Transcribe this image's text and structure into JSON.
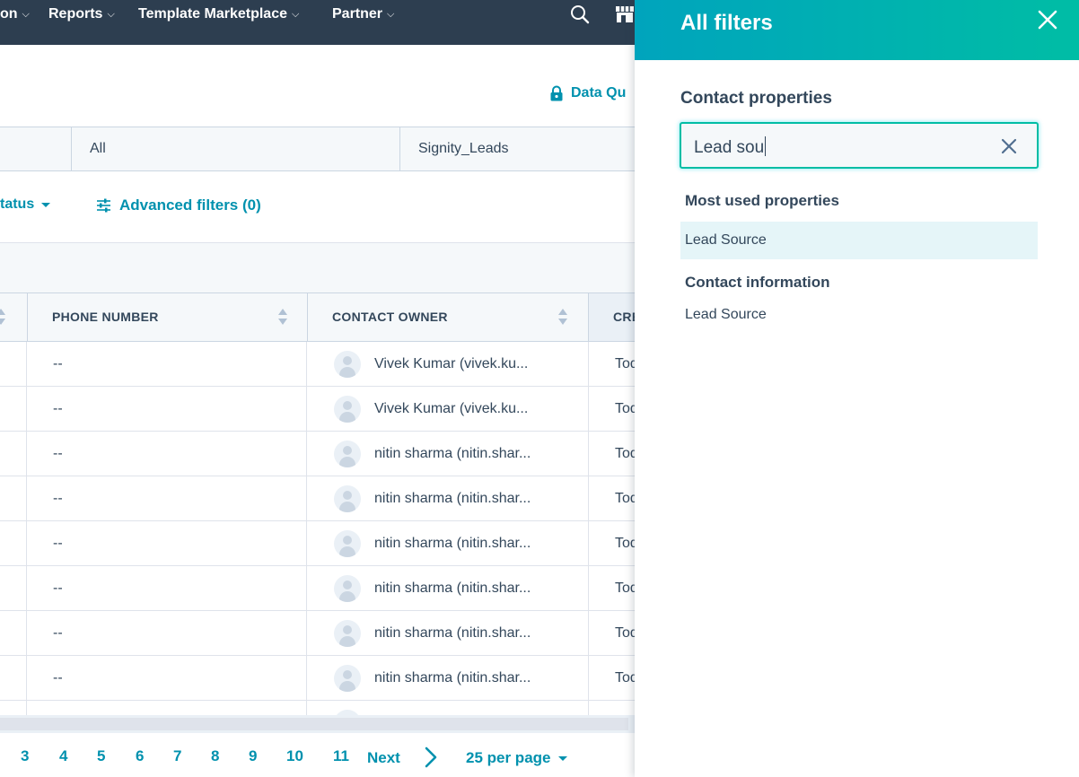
{
  "nav": {
    "items": [
      {
        "label": "on",
        "chevron": "⌵"
      },
      {
        "label": "Reports",
        "chevron": "⌵"
      },
      {
        "label": "Template Marketplace",
        "chevron": "⌵"
      },
      {
        "label": "Partner",
        "chevron": "⌵"
      }
    ],
    "icons": [
      "search-icon",
      "marketplace-icon"
    ]
  },
  "data_quality": {
    "label": "Data Qu",
    "icon": "lock-icon"
  },
  "view_tabs": [
    {
      "label": ""
    },
    {
      "label": "All"
    },
    {
      "label": "Signity_Leads"
    }
  ],
  "filters": {
    "status_label": "tatus",
    "advanced_label": "Advanced filters (0)",
    "advanced_icon": "sliders-icon"
  },
  "table": {
    "columns": [
      {
        "label": "PHONE NUMBER"
      },
      {
        "label": "CONTACT OWNER"
      },
      {
        "label": "CRE"
      }
    ],
    "rows": [
      {
        "phone": "--",
        "owner": "Vivek Kumar (vivek.ku...",
        "created": "Tod"
      },
      {
        "phone": "--",
        "owner": "Vivek Kumar (vivek.ku...",
        "created": "Tod"
      },
      {
        "phone": "--",
        "owner": "nitin sharma (nitin.shar...",
        "created": "Tod"
      },
      {
        "phone": "--",
        "owner": "nitin sharma (nitin.shar...",
        "created": "Tod"
      },
      {
        "phone": "--",
        "owner": "nitin sharma (nitin.shar...",
        "created": "Tod"
      },
      {
        "phone": "--",
        "owner": "nitin sharma (nitin.shar...",
        "created": "Tod"
      },
      {
        "phone": "--",
        "owner": "nitin sharma (nitin.shar...",
        "created": "Tod"
      },
      {
        "phone": "--",
        "owner": "nitin sharma (nitin.shar...",
        "created": "Tod"
      }
    ]
  },
  "pagination": {
    "pages": [
      "3",
      "4",
      "5",
      "6",
      "7",
      "8",
      "9",
      "10",
      "11"
    ],
    "next_label": "Next",
    "per_page_label": "25 per page"
  },
  "panel": {
    "title": "All filters",
    "section_title": "Contact properties",
    "search_value": "Lead sou",
    "groups": [
      {
        "title": "Most used properties",
        "items": [
          "Lead Source"
        ]
      },
      {
        "title": "Contact information",
        "items": [
          "Lead Source"
        ]
      }
    ]
  },
  "colors": {
    "nav_bg": "#2d3e50",
    "accent": "#0091ae",
    "panel_gradient_start": "#00a4bd",
    "panel_gradient_end": "#00bda5",
    "text": "#33475b",
    "highlight": "#e5f5f8"
  }
}
